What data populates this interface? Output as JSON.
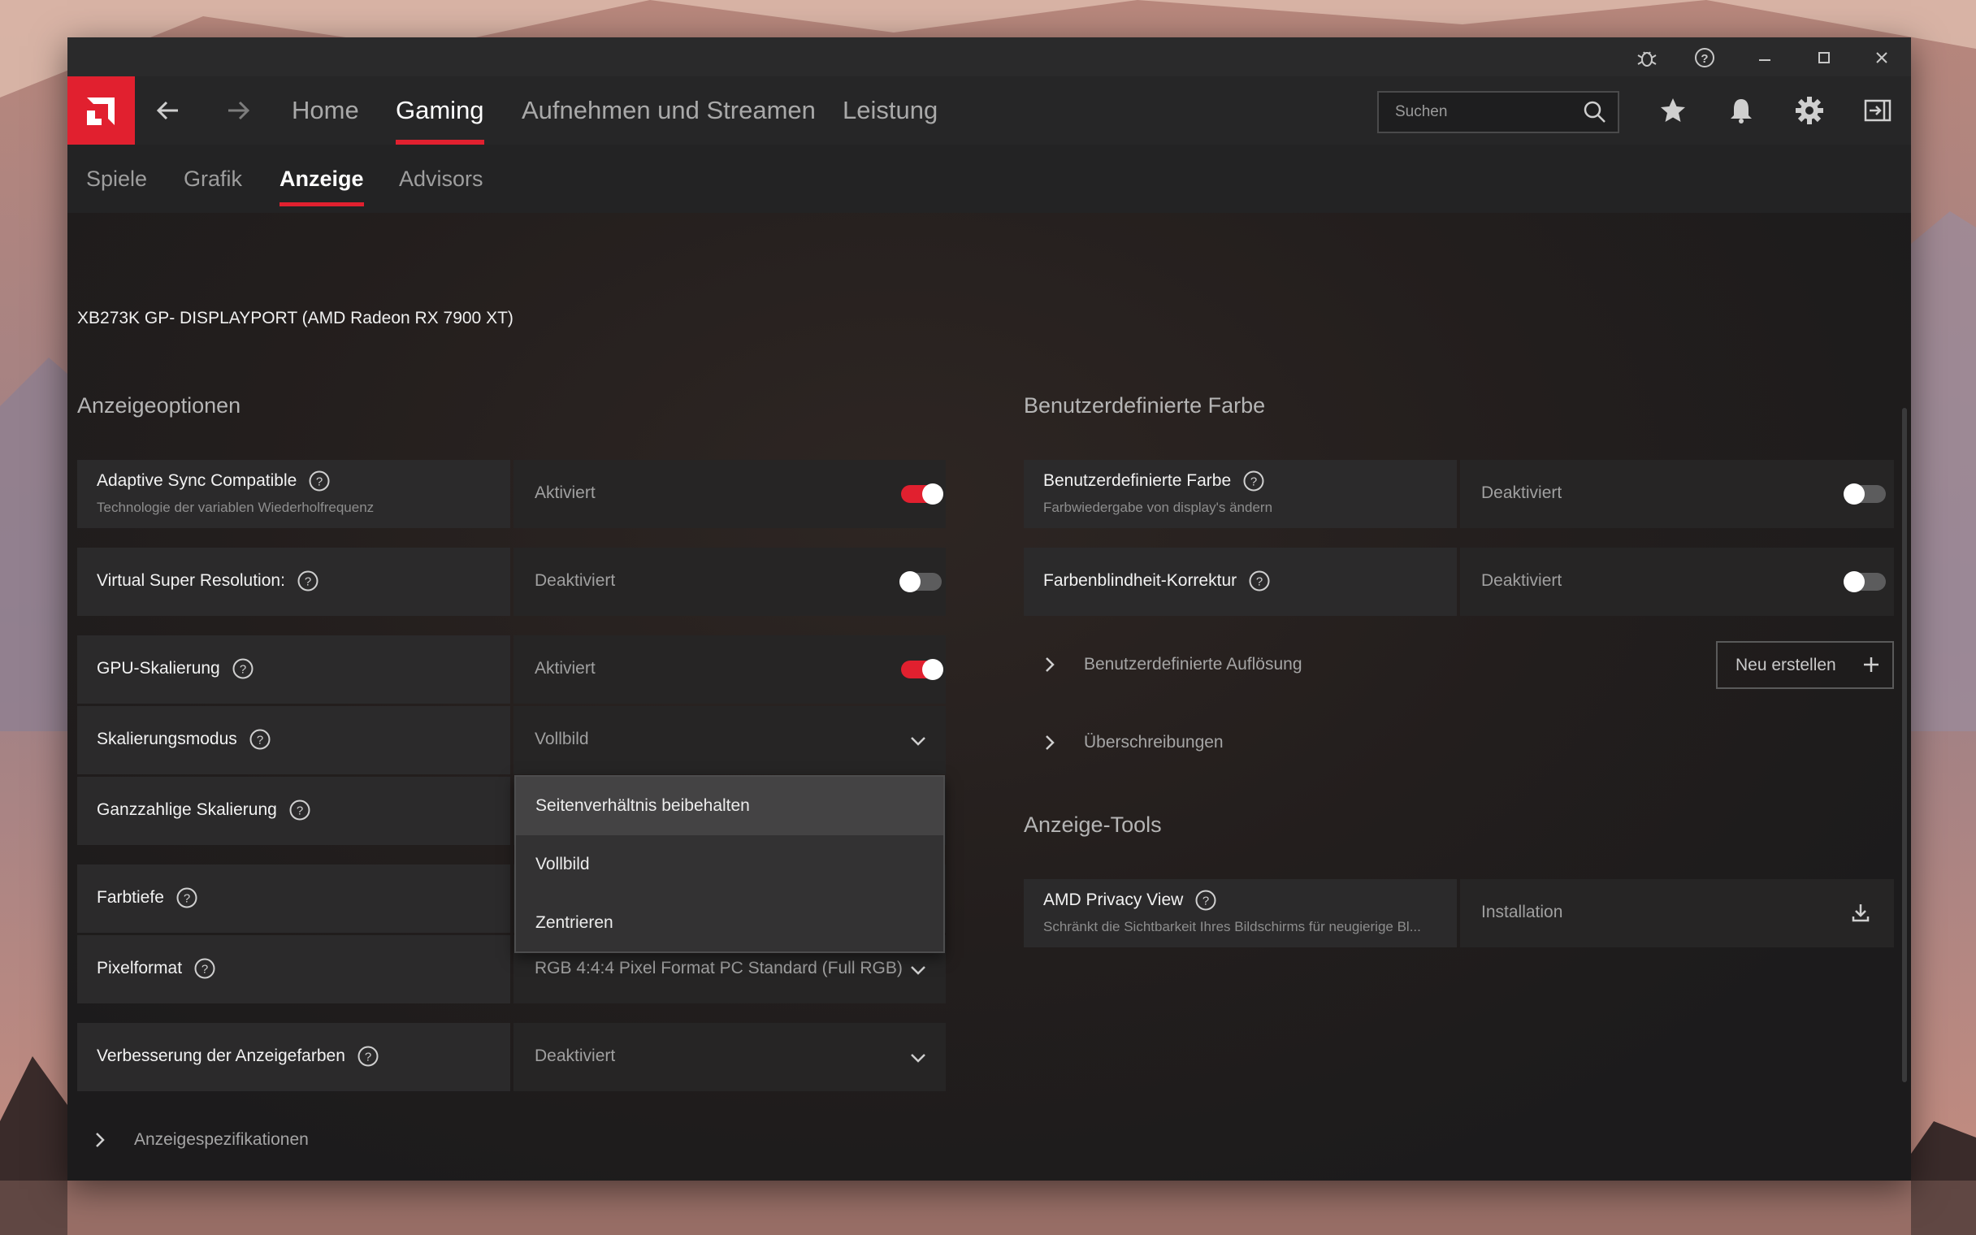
{
  "window": {
    "title_icons": [
      "bug-icon",
      "help-icon",
      "minimize-icon",
      "maximize-icon",
      "close-icon"
    ]
  },
  "nav": {
    "tabs": [
      {
        "label": "Home",
        "active": false
      },
      {
        "label": "Gaming",
        "active": true
      },
      {
        "label": "Aufnehmen und Streamen",
        "active": false
      },
      {
        "label": "Leistung",
        "active": false
      }
    ],
    "search_placeholder": "Suchen"
  },
  "subnav": {
    "tabs": [
      {
        "label": "Spiele",
        "active": false
      },
      {
        "label": "Grafik",
        "active": false
      },
      {
        "label": "Anzeige",
        "active": true
      },
      {
        "label": "Advisors",
        "active": false
      }
    ]
  },
  "device": "XB273K GP- DISPLAYPORT (AMD Radeon RX 7900 XT)",
  "left": {
    "title": "Anzeigeoptionen",
    "rows": [
      {
        "label": "Adaptive Sync Compatible",
        "sub": "Technologie der variablen Wiederholfrequenz",
        "value": "Aktiviert",
        "control": "toggle",
        "on": true
      },
      {
        "label": "Virtual Super Resolution:",
        "value": "Deaktiviert",
        "control": "toggle",
        "on": false
      },
      {
        "label": "GPU-Skalierung",
        "value": "Aktiviert",
        "control": "toggle",
        "on": true
      },
      {
        "label": "Skalierungsmodus",
        "value": "Vollbild",
        "control": "dropdown"
      },
      {
        "label": "Ganzzahlige Skalierung",
        "value": "",
        "control": "none"
      },
      {
        "label": "Farbtiefe",
        "value": "",
        "control": "none"
      },
      {
        "label": "Pixelformat",
        "value": "RGB 4:4:4 Pixel Format PC Standard (Full RGB)",
        "control": "dropdown"
      },
      {
        "label": "Verbesserung der Anzeigefarben",
        "value": "Deaktiviert",
        "control": "dropdown"
      }
    ],
    "dropdown_options": [
      "Seitenverhältnis beibehalten",
      "Vollbild",
      "Zentrieren"
    ],
    "expander": "Anzeigespezifikationen"
  },
  "right": {
    "title": "Benutzerdefinierte Farbe",
    "rows": [
      {
        "label": "Benutzerdefinierte Farbe",
        "sub": "Farbwiedergabe von display's ändern",
        "value": "Deaktiviert",
        "control": "toggle",
        "on": false
      },
      {
        "label": "Farbenblindheit-Korrektur",
        "value": "Deaktiviert",
        "control": "toggle",
        "on": false
      }
    ],
    "expanders": [
      "Benutzerdefinierte Auflösung",
      "Überschreibungen"
    ],
    "new_button": "Neu erstellen",
    "tools_title": "Anzeige-Tools",
    "tools": [
      {
        "label": "AMD Privacy View",
        "sub": "Schränkt die Sichtbarkeit Ihres Bildschirms für neugierige Bl...",
        "value": "Installation",
        "control": "download"
      }
    ]
  },
  "colors": {
    "accent": "#e1202f",
    "bg": "#1d1d1e"
  }
}
